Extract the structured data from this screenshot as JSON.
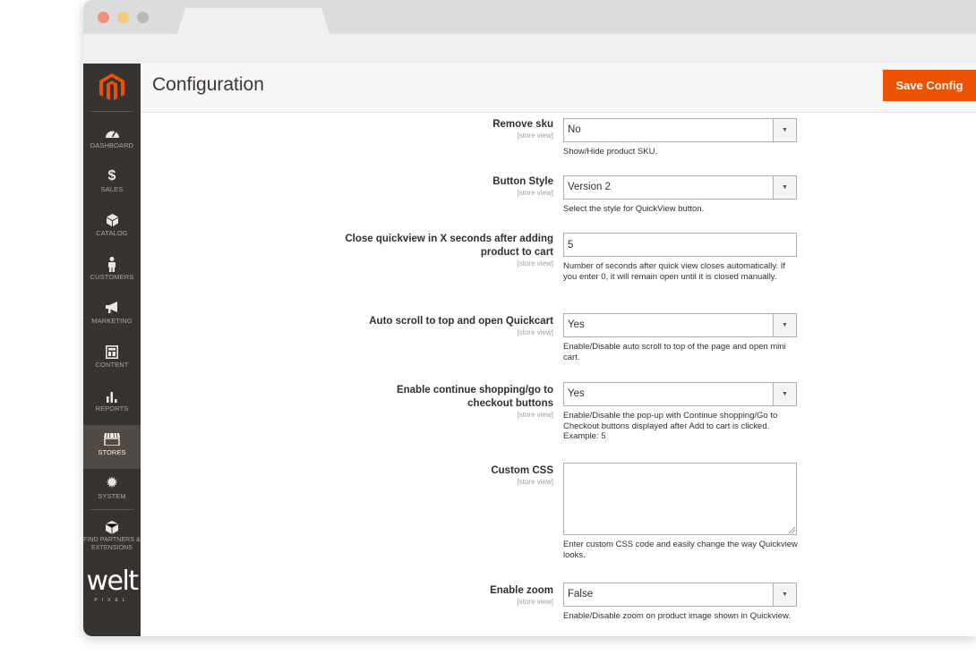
{
  "window": {
    "dot_colors": [
      "#f09079",
      "#f5c97b",
      "#b9b9b9"
    ],
    "accent": "#eb5202"
  },
  "sidebar": {
    "items": [
      {
        "label": "DASHBOARD",
        "icon": "dashboard-icon"
      },
      {
        "label": "SALES",
        "icon": "dollar-icon"
      },
      {
        "label": "CATALOG",
        "icon": "box-icon"
      },
      {
        "label": "CUSTOMERS",
        "icon": "person-icon"
      },
      {
        "label": "MARKETING",
        "icon": "megaphone-icon"
      },
      {
        "label": "CONTENT",
        "icon": "layout-icon"
      },
      {
        "label": "REPORTS",
        "icon": "bar-chart-icon"
      },
      {
        "label": "STORES",
        "icon": "storefront-icon",
        "active": true
      },
      {
        "label": "SYSTEM",
        "icon": "gear-icon"
      },
      {
        "label": "FIND PARTNERS & EXTENSIONS",
        "icon": "cube-icon"
      }
    ],
    "brand": "welt",
    "brand_sub": "PIXEL"
  },
  "header": {
    "title": "Configuration",
    "save_label": "Save Config"
  },
  "fields": [
    {
      "label": "Remove sku",
      "scope": "[store view]",
      "type": "select",
      "value": "No",
      "note": "Show/Hide product SKU."
    },
    {
      "label": "Button Style",
      "scope": "[store view]",
      "type": "select",
      "value": "Version 2",
      "note": "Select the style for QuickView button."
    },
    {
      "label": "Close quickview in X seconds after adding product to cart",
      "scope": "[store view]",
      "type": "text",
      "value": "5",
      "note": "Number of seconds after quick view closes automatically. If you enter 0, it will remain open until it is closed manually."
    },
    {
      "label": "Auto scroll to top and open Quickcart",
      "scope": "[store view]",
      "type": "select",
      "value": "Yes",
      "note": "Enable/Disable auto scroll to top of the page and open mini cart."
    },
    {
      "label": "Enable continue shopping/go to checkout buttons",
      "scope": "[store view]",
      "type": "select",
      "value": "Yes",
      "note": "Enable/Disable the pop-up with Continue shopping/Go to Checkout buttons displayed after Add to cart is clicked. Example: 5"
    },
    {
      "label": "Custom CSS",
      "scope": "[store view]",
      "type": "textarea",
      "value": "",
      "note": "Enter custom CSS code and easily change the way Quickview looks."
    },
    {
      "label": "Enable zoom",
      "scope": "[store view]",
      "type": "select",
      "value": "False",
      "note": "Enable/Disable zoom on product image shown in Quickview."
    }
  ]
}
